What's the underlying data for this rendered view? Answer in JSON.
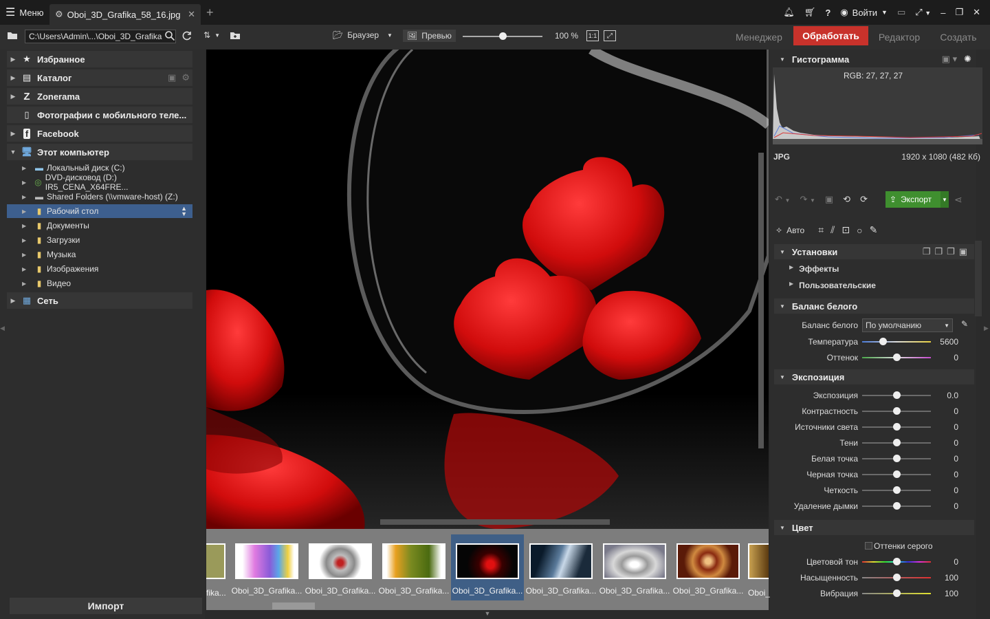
{
  "titlebar": {
    "menu_label": "Меню",
    "tab_title": "Oboi_3D_Grafika_58_16.jpg",
    "login_label": "Войти"
  },
  "toolbar": {
    "path": "C:\\Users\\Admin\\...\\Oboi_3D_Grafika",
    "browser_label": "Браузер",
    "preview_label": "Превью",
    "zoom": "100 %",
    "one_to_one": "1:1",
    "zoom_level": 0.5
  },
  "modes": {
    "manager": "Менеджер",
    "process": "Обработать",
    "editor": "Редактор",
    "create": "Создать"
  },
  "nav": {
    "favorites": "Избранное",
    "catalog": "Каталог",
    "zonerama": "Zonerama",
    "mobile": "Фотографии с мобильного теле...",
    "facebook": "Facebook",
    "this_pc": "Этот компьютер",
    "drives": [
      {
        "label": "Локальный диск (C:)",
        "icon": "hard-drive-icon"
      },
      {
        "label": "DVD-дисковод (D:) IR5_CENA_X64FRE...",
        "icon": "dvd-icon"
      },
      {
        "label": "Shared Folders (\\\\vmware-host) (Z:)",
        "icon": "network-drive-icon"
      },
      {
        "label": "Рабочий стол",
        "icon": "folder-icon"
      },
      {
        "label": "Документы",
        "icon": "folder-icon"
      },
      {
        "label": "Загрузки",
        "icon": "folder-icon"
      },
      {
        "label": "Музыка",
        "icon": "folder-icon"
      },
      {
        "label": "Изображения",
        "icon": "folder-icon"
      },
      {
        "label": "Видео",
        "icon": "folder-icon"
      }
    ],
    "network": "Сеть",
    "import_label": "Импорт"
  },
  "filmstrip": {
    "partial_left": "fika...",
    "items": [
      "Oboi_3D_Grafika...",
      "Oboi_3D_Grafika...",
      "Oboi_3D_Grafika...",
      "Oboi_3D_Grafika...",
      "Oboi_3D_Grafika...",
      "Oboi_3D_Grafika...",
      "Oboi_3D_Grafika..."
    ],
    "partial_right": "Oboi_",
    "selected_index": 3
  },
  "right": {
    "histogram_title": "Гистограмма",
    "rgb_readout": "RGB: 27, 27, 27",
    "format": "JPG",
    "dimensions": "1920 x 1080 (482 Кб)",
    "export_label": "Экспорт",
    "auto_label": "Авто",
    "presets_title": "Установки",
    "effects": "Эффекты",
    "custom": "Пользовательские",
    "wb_title": "Баланс белого",
    "wb_label": "Баланс белого",
    "wb_value": "По умолчанию",
    "temperature_label": "Температура",
    "temperature_value": "5600",
    "temperature_level": 0.3,
    "tint_label": "Оттенок",
    "tint_value": "0",
    "exposure_title": "Экспозиция",
    "exposure_rows": [
      {
        "label": "Экспозиция",
        "value": "0.0"
      },
      {
        "label": "Контрастность",
        "value": "0"
      },
      {
        "label": "Источники света",
        "value": "0"
      },
      {
        "label": "Тени",
        "value": "0"
      },
      {
        "label": "Белая точка",
        "value": "0"
      },
      {
        "label": "Черная точка",
        "value": "0"
      },
      {
        "label": "Четкость",
        "value": "0"
      },
      {
        "label": "Удаление дымки",
        "value": "0"
      }
    ],
    "color_title": "Цвет",
    "grayscale_label": "Оттенки серого",
    "hue_label": "Цветовой тон",
    "hue_value": "0",
    "saturation_label": "Насыщенность",
    "saturation_value": "100",
    "vibrance_label": "Вибрация",
    "vibrance_value": "100"
  },
  "colors": {
    "accent_process": "#c8322b",
    "export_green": "#3f8f2f",
    "selection_blue": "#3d5f8e"
  }
}
